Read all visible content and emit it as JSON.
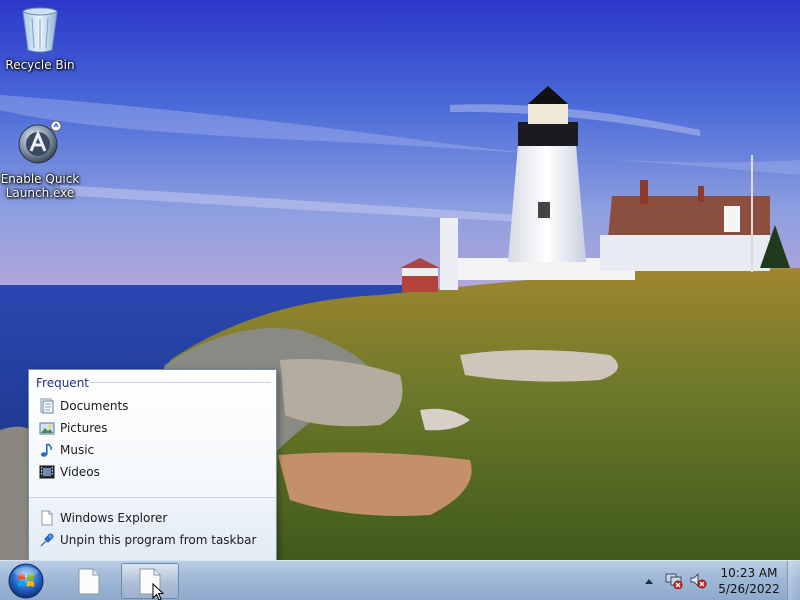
{
  "desktop": {
    "icons": [
      {
        "label": "Recycle Bin",
        "icon": "recycle-bin-icon"
      },
      {
        "label": "Enable Quick Launch.exe",
        "icon": "app-shortcut-icon"
      }
    ]
  },
  "jumplist": {
    "frequent_title": "Frequent",
    "frequent_items": [
      {
        "label": "Documents",
        "icon": "documents-icon"
      },
      {
        "label": "Pictures",
        "icon": "pictures-icon"
      },
      {
        "label": "Music",
        "icon": "music-icon"
      },
      {
        "label": "Videos",
        "icon": "videos-icon"
      }
    ],
    "tasks": [
      {
        "label": "Windows Explorer",
        "icon": "document-icon"
      },
      {
        "label": "Unpin this program from taskbar",
        "icon": "pin-icon"
      }
    ]
  },
  "taskbar": {
    "start_icon": "windows-start-icon",
    "buttons": [
      {
        "icon": "document-icon",
        "active": false
      },
      {
        "icon": "document-icon",
        "active": true
      }
    ]
  },
  "tray": {
    "icons": [
      "tray-expand-icon",
      "network-icon",
      "volume-muted-icon"
    ],
    "time": "10:23 AM",
    "date": "5/26/2022"
  },
  "colors": {
    "taskbar": "#9fb8d6",
    "jumplist_title": "#1e3287"
  }
}
